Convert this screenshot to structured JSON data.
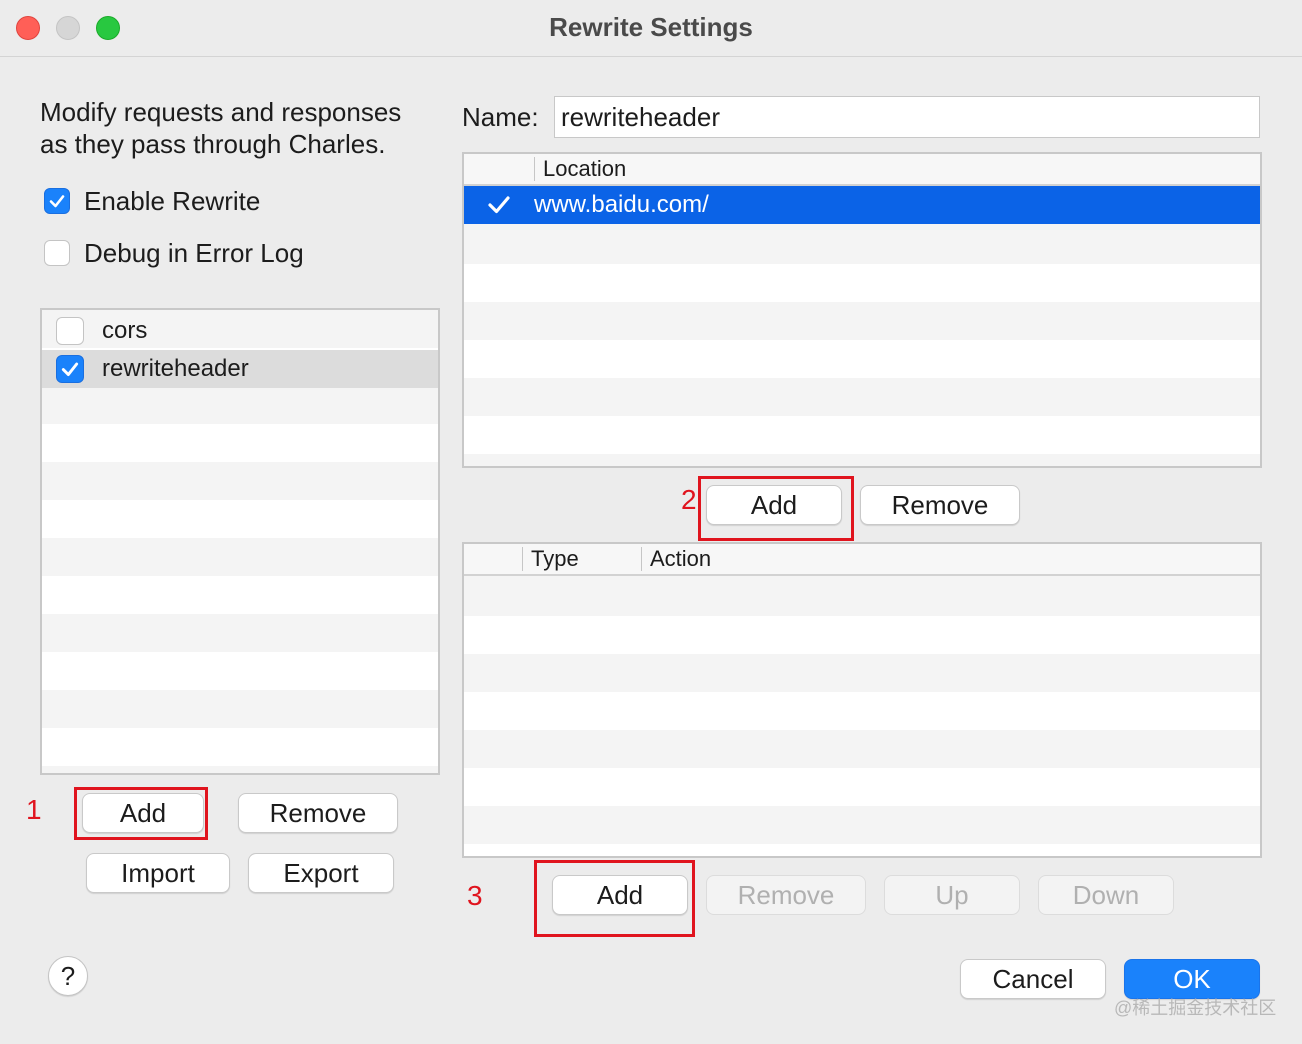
{
  "window": {
    "title": "Rewrite Settings"
  },
  "left": {
    "description_line1": "Modify requests and responses",
    "description_line2": "as they pass through Charles.",
    "enable_rewrite": {
      "label": "Enable Rewrite",
      "checked": true
    },
    "debug_error_log": {
      "label": "Debug in Error Log",
      "checked": false
    },
    "sets": [
      {
        "name": "cors",
        "enabled": false,
        "selected": false
      },
      {
        "name": "rewriteheader",
        "enabled": true,
        "selected": true
      }
    ],
    "add_label": "Add",
    "remove_label": "Remove",
    "import_label": "Import",
    "export_label": "Export"
  },
  "right": {
    "name_label": "Name:",
    "name_value": "rewriteheader",
    "locations": {
      "column_location": "Location",
      "rows": [
        {
          "location": "www.baidu.com/",
          "enabled": true,
          "selected": true
        }
      ]
    },
    "location_add_label": "Add",
    "location_remove_label": "Remove",
    "rules": {
      "column_type": "Type",
      "column_action": "Action",
      "rows": []
    },
    "rule_add_label": "Add",
    "rule_remove_label": "Remove",
    "rule_up_label": "Up",
    "rule_down_label": "Down"
  },
  "footer": {
    "help_label": "?",
    "cancel_label": "Cancel",
    "ok_label": "OK"
  },
  "annotations": {
    "one": "1",
    "two": "2",
    "three": "3"
  },
  "watermark": "@稀土掘金技术社区",
  "colors": {
    "accent": "#1a82fb",
    "selection": "#0b63e7",
    "annotation": "#e0141e"
  }
}
